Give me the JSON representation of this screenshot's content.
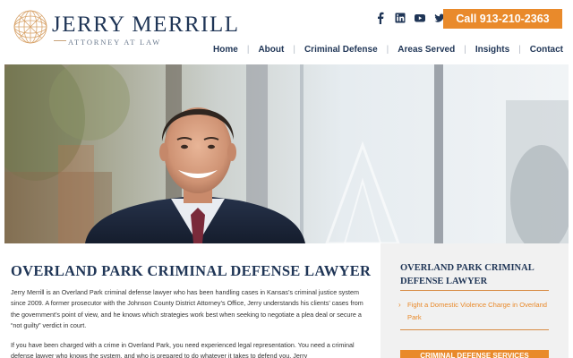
{
  "brand": {
    "name": "JERRY MERRILL",
    "tagline": "ATTORNEY AT LAW",
    "colors": {
      "navy": "#1f3556",
      "orange": "#e98a2b",
      "gold": "#c9a37a"
    }
  },
  "header": {
    "social_icons": [
      "facebook-icon",
      "linkedin-icon",
      "youtube-icon",
      "twitter-icon"
    ],
    "call_label": "Call 913-210-2363"
  },
  "nav": {
    "items": [
      {
        "label": "Home"
      },
      {
        "label": "About"
      },
      {
        "label": "Criminal Defense"
      },
      {
        "label": "Areas Served"
      },
      {
        "label": "Insights"
      },
      {
        "label": "Contact"
      }
    ]
  },
  "main": {
    "title": "OVERLAND PARK CRIMINAL DEFENSE LAWYER",
    "paragraphs": [
      "Jerry Merrill is an Overland Park criminal defense lawyer who has been handling cases in Kansas’s criminal justice system since 2009. A former prosecutor with the Johnson County District Attorney’s Office, Jerry understands his clients’ cases from the government’s point of view, and he knows which strategies work best when seeking to negotiate a plea deal or secure a “not guilty” verdict in court.",
      "If you have been charged with a crime in Overland Park, you need experienced legal representation. You need a criminal defense lawyer who knows the system, and who is prepared to do whatever it takes to defend you. Jerry"
    ]
  },
  "sidebar": {
    "title": "OVERLAND PARK CRIMINAL DEFENSE LAWYER",
    "links": [
      {
        "label": "Fight a Domestic Violence Charge in Overland Park"
      }
    ],
    "button_label": "CRIMINAL DEFENSE SERVICES"
  }
}
